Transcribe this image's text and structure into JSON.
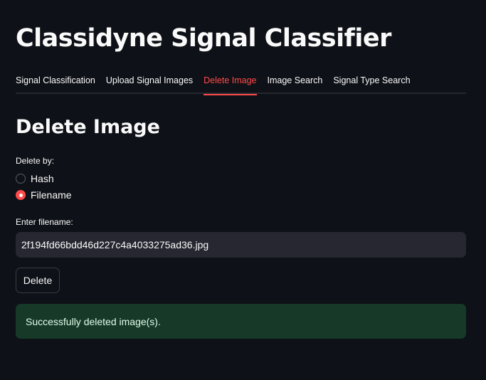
{
  "app": {
    "title": "Classidyne Signal Classifier"
  },
  "tabs": [
    {
      "label": "Signal Classification",
      "active": false
    },
    {
      "label": "Upload Signal Images",
      "active": false
    },
    {
      "label": "Delete Image",
      "active": true
    },
    {
      "label": "Image Search",
      "active": false
    },
    {
      "label": "Signal Type Search",
      "active": false
    }
  ],
  "section": {
    "title": "Delete Image"
  },
  "delete_by": {
    "label": "Delete by:",
    "options": [
      {
        "label": "Hash",
        "selected": false
      },
      {
        "label": "Filename",
        "selected": true
      }
    ]
  },
  "filename_input": {
    "label": "Enter filename:",
    "value": "2f194fd66bdd46d227c4a4033275ad36.jpg"
  },
  "actions": {
    "delete_label": "Delete"
  },
  "alert": {
    "message": "Successfully deleted image(s)."
  },
  "colors": {
    "background": "#0e1117",
    "accent": "#ff4b4b",
    "input_background": "#262730",
    "success_background": "#173928",
    "success_text": "#dffde9"
  }
}
